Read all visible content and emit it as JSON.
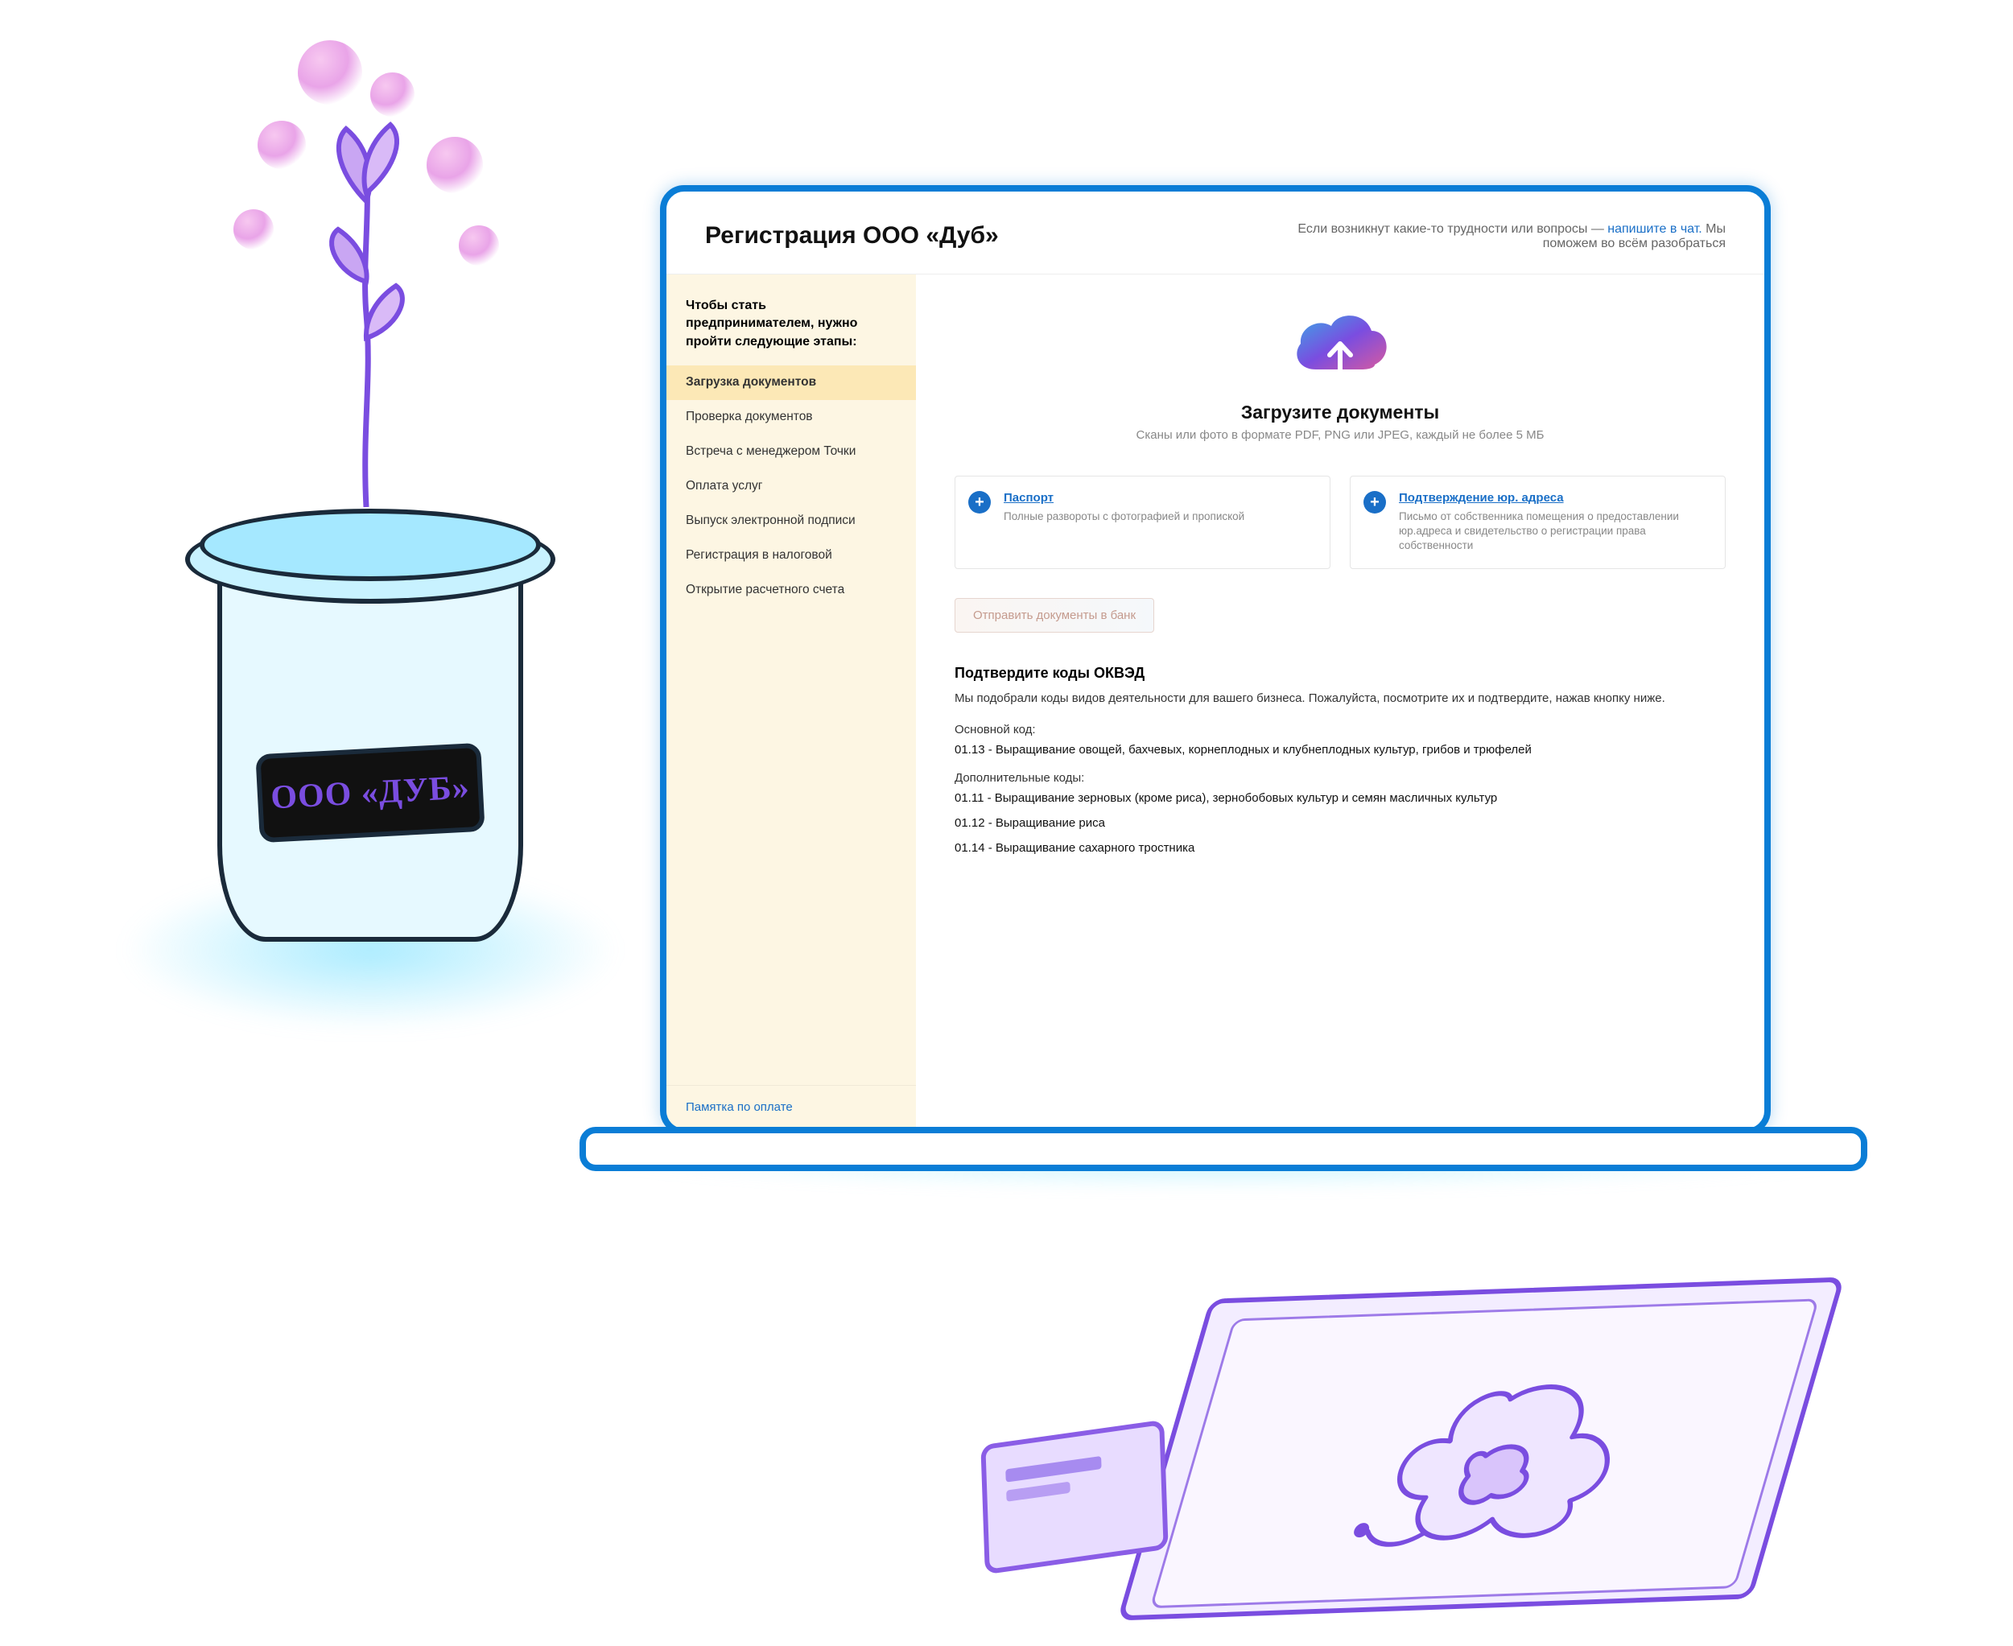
{
  "header": {
    "title": "Регистрация ООО «Дуб»",
    "help_prefix": "Если возникнут какие-то трудности или вопросы — ",
    "help_link": "напишите в чат.",
    "help_suffix": " Мы поможем во всём разобраться"
  },
  "sidebar": {
    "title": "Чтобы стать предпринимателем, нужно пройти следующие этапы:",
    "steps": [
      "Загрузка документов",
      "Проверка документов",
      "Встреча с менеджером Точки",
      "Оплата услуг",
      "Выпуск электронной подписи",
      "Регистрация в налоговой",
      "Открытие расчетного счета"
    ],
    "bottom_link": "Памятка по оплате"
  },
  "upload": {
    "title": "Загрузите документы",
    "subtitle": "Сканы или фото в формате PDF, PNG или JPEG, каждый не более 5 МБ"
  },
  "docs": {
    "passport": {
      "title": "Паспорт",
      "desc": "Полные развороты с фотографией и пропиской"
    },
    "address": {
      "title": "Подтверждение юр. адреса",
      "desc": "Письмо от собственника помещения о предоставлении юр.адреса и свидетельство о регистрации права собственности"
    }
  },
  "submit_label": "Отправить документы в банк",
  "okved": {
    "heading": "Подтвердите коды ОКВЭД",
    "intro": "Мы подобрали коды видов деятельности для вашего бизнеса. Пожалуйста, посмотрите их и подтвердите, нажав кнопку ниже.",
    "primary_label": "Основной код:",
    "primary": "01.13 - Выращивание овощей, бахчевых, корнеплодных и клубнеплодных культур, грибов и трюфелей",
    "additional_label": "Дополнительные коды:",
    "codes": [
      "01.11 - Выращивание зерновых (кроме риса), зернобобовых культур и семян масличных культур",
      "01.12 - Выращивание риса",
      "01.14 - Выращивание сахарного тростника"
    ]
  },
  "pot_label": "ООО «ДУБ»"
}
